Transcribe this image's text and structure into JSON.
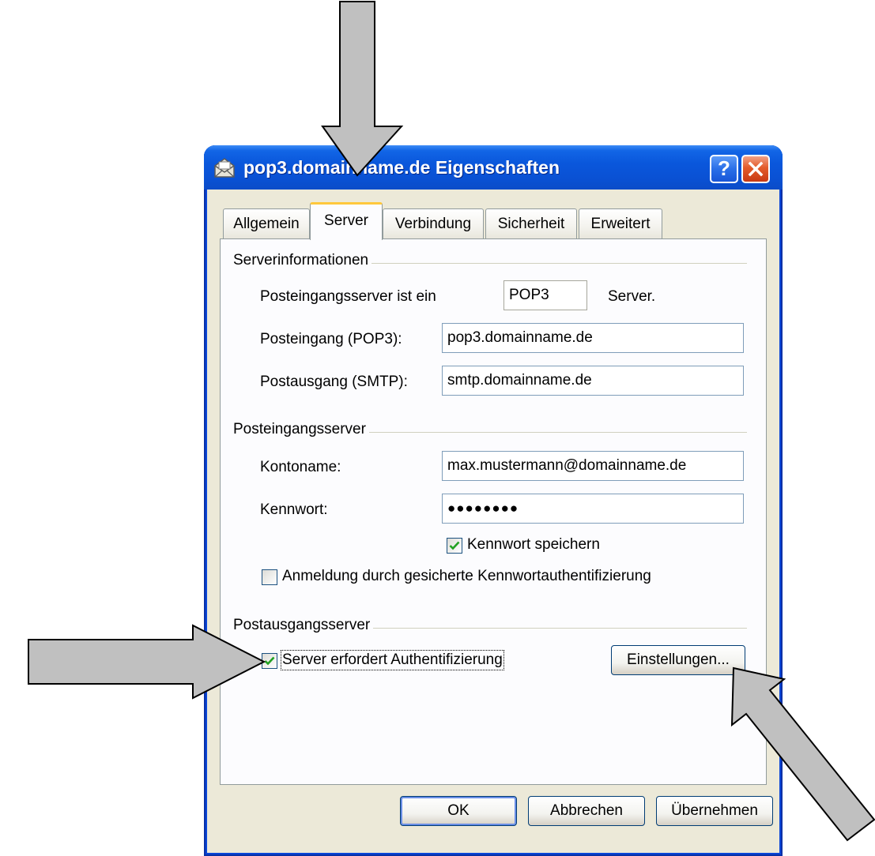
{
  "window": {
    "title": "pop3.domainname.de Eigenschaften",
    "help_label": "?",
    "icon": "mail-account-icon"
  },
  "tabs": [
    {
      "label": "Allgemein",
      "active": false
    },
    {
      "label": "Server",
      "active": true
    },
    {
      "label": "Verbindung",
      "active": false
    },
    {
      "label": "Sicherheit",
      "active": false
    },
    {
      "label": "Erweitert",
      "active": false
    }
  ],
  "server_info": {
    "group_label": "Serverinformationen",
    "type_label": "Posteingangsserver ist ein",
    "type_value": "POP3",
    "type_suffix": "Server.",
    "incoming_label": "Posteingang (POP3):",
    "incoming_value": "pop3.domainname.de",
    "outgoing_label": "Postausgang (SMTP):",
    "outgoing_value": "smtp.domainname.de"
  },
  "incoming_server": {
    "group_label": "Posteingangsserver",
    "account_label": "Kontoname:",
    "account_value": "max.mustermann@domainname.de",
    "password_label": "Kennwort:",
    "password_value": "●●●●●●●●",
    "save_password_label": "Kennwort speichern",
    "save_password_checked": true,
    "spa_label": "Anmeldung durch gesicherte Kennwortauthentifizierung",
    "spa_checked": false
  },
  "outgoing_server": {
    "group_label": "Postausgangsserver",
    "auth_label": "Server erfordert Authentifizierung",
    "auth_checked": true,
    "settings_button": "Einstellungen..."
  },
  "footer": {
    "ok_label": "OK",
    "cancel_label": "Abbrechen",
    "apply_label": "Übernehmen"
  },
  "colors": {
    "title_blue": "#0a57dc",
    "dialog_face": "#ece9d8",
    "check_green": "#21a121",
    "arrow_gray": "#c0c0c0"
  }
}
